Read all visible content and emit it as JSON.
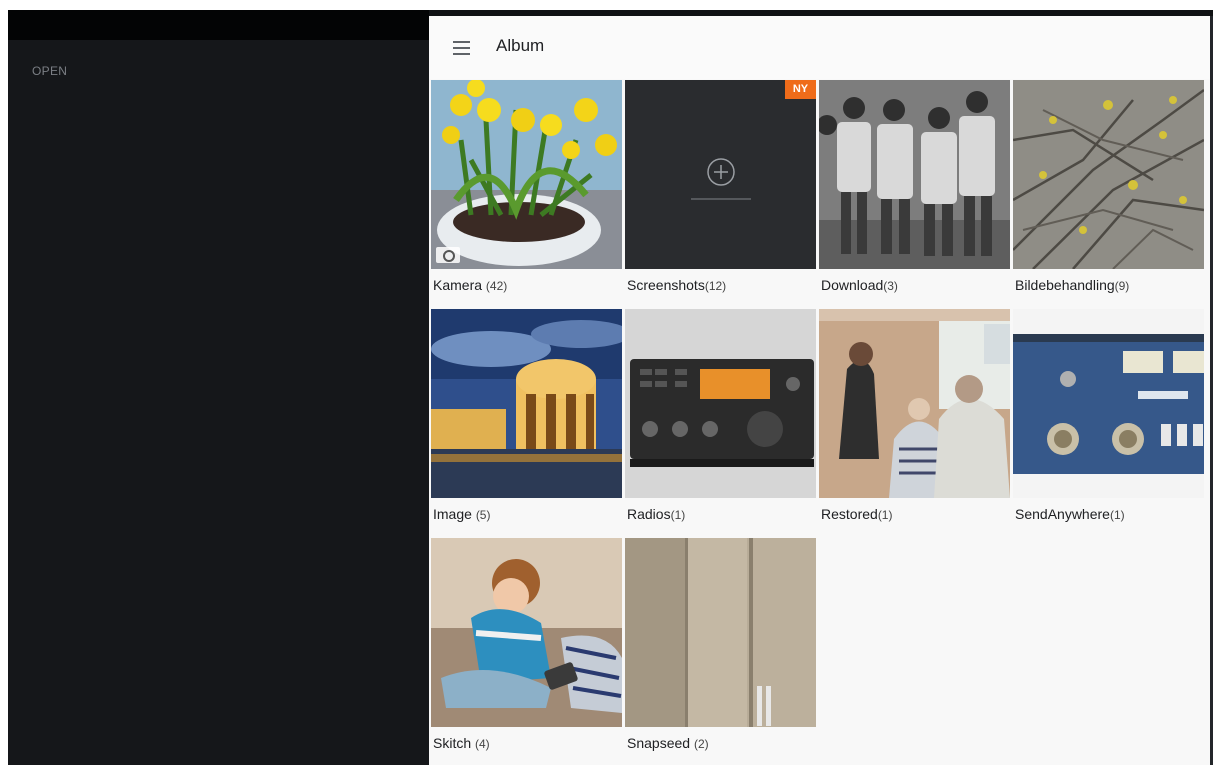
{
  "left_panel": {
    "open_label": "OPEN"
  },
  "app_bar": {
    "title": "Album",
    "menu_icon": "hamburger-menu-icon"
  },
  "new_badge": "NY",
  "albums": [
    {
      "name": "Kamera",
      "count": "(42)"
    },
    {
      "name": "Screenshots",
      "count": "(12)"
    },
    {
      "name": "Download",
      "count": "(3)"
    },
    {
      "name": "Bildebehandling",
      "count": "(9)"
    },
    {
      "name": "Image",
      "count": "(5)"
    },
    {
      "name": "Radios",
      "count": "(1)"
    },
    {
      "name": "Restored",
      "count": "(1)"
    },
    {
      "name": "SendAnywhere",
      "count": "(1)"
    },
    {
      "name": "Skitch",
      "count": "(4)"
    },
    {
      "name": "Snapseed",
      "count": "(2)"
    }
  ],
  "colors": {
    "accent_badge": "#ef6c1a",
    "left_panel_bg": "#15171a",
    "grid_bg": "#f8f8f8"
  }
}
